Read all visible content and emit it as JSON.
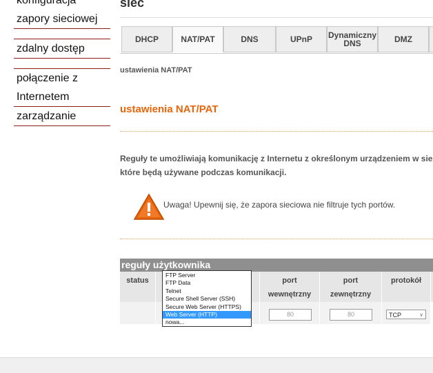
{
  "sidebar": {
    "items": [
      {
        "label": "konfiguracja"
      },
      {
        "label": "zapory sieciowej"
      },
      {
        "label": "zdalny dostęp"
      },
      {
        "label": "połączenie z"
      },
      {
        "label": "Internetem"
      },
      {
        "label": "zarządzanie"
      }
    ]
  },
  "header": {
    "title": "sieć"
  },
  "tabs": [
    {
      "label": "DHCP"
    },
    {
      "label": "NAT/PAT"
    },
    {
      "label": "DNS"
    },
    {
      "label": "UPnP"
    },
    {
      "label": "Dynamiczny DNS"
    },
    {
      "label": "DMZ"
    }
  ],
  "active_tab": "NAT/PAT",
  "breadcrumb": "ustawienia NAT/PAT",
  "section_title": "ustawienia NAT/PAT",
  "description": {
    "line1": "Reguły te umożliwiają komunikację z Internetu z określonym urządzeniem w sie",
    "line2": "które będą używane podczas komunikacji."
  },
  "warning": "Uwaga! Upewnij się, że zapora sieciowa nie filtruje tych portów.",
  "rules": {
    "title": "reguły użytkownika",
    "columns": {
      "status": "status",
      "internal_port_1": "port",
      "internal_port_2": "wewnętrzny",
      "external_port_1": "port",
      "external_port_2": "zewnętrzny",
      "protocol": "protokół"
    },
    "row": {
      "internal_port": "80",
      "external_port": "80",
      "protocol": "TCP"
    }
  },
  "application_dropdown": {
    "options": [
      "FTP Server",
      "FTP Data",
      "Telnet",
      "Secure Shell Server (SSH)",
      "Secure Web Server (HTTPS)",
      "Web Server (HTTP)",
      "nowa..."
    ],
    "selected": "Web Server (HTTP)"
  },
  "colors": {
    "accent": "#e8650a",
    "separator": "#8b1a1a",
    "table_header": "#8f8f8f",
    "selection": "#3399ff"
  }
}
